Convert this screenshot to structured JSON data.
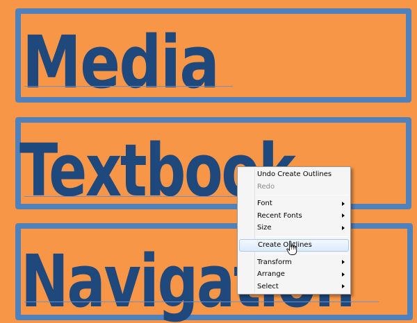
{
  "canvas": {
    "words": [
      "Media",
      "Textbook",
      "Navigation"
    ],
    "colors": {
      "background": "#F79646",
      "frame": "#4F81BD",
      "text": "#1F497D"
    }
  },
  "context_menu": {
    "groups": [
      [
        {
          "label": "Undo Create Outlines",
          "enabled": true,
          "submenu": false
        },
        {
          "label": "Redo",
          "enabled": false,
          "submenu": false
        }
      ],
      [
        {
          "label": "Font",
          "enabled": true,
          "submenu": true
        },
        {
          "label": "Recent Fonts",
          "enabled": true,
          "submenu": true
        },
        {
          "label": "Size",
          "enabled": true,
          "submenu": true
        }
      ],
      [
        {
          "label": "Create Outlines",
          "enabled": true,
          "submenu": false,
          "hovered": true
        }
      ],
      [
        {
          "label": "Transform",
          "enabled": true,
          "submenu": true
        },
        {
          "label": "Arrange",
          "enabled": true,
          "submenu": true
        },
        {
          "label": "Select",
          "enabled": true,
          "submenu": true
        }
      ]
    ]
  },
  "cursor": {
    "icon": "hand-pointer-icon"
  }
}
